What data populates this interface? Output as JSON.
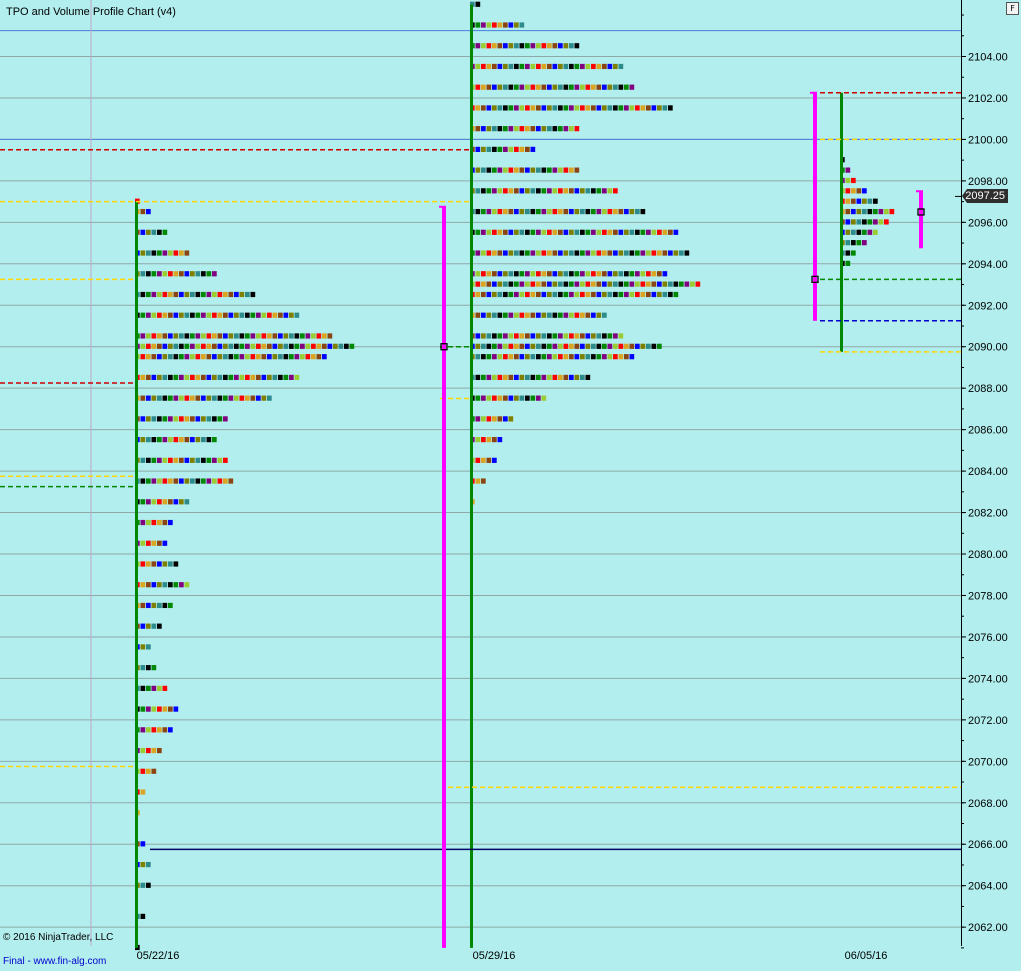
{
  "app": {
    "title": "TPO and Volume Profile Chart (v4)",
    "copyright": "© 2016 NinjaTrader, LLC",
    "footer_link": "Final - www.fin-alg.com",
    "corner_button": "F",
    "last_price": "2097.25"
  },
  "colors": {
    "background": "#b2eeee",
    "grid": "#8fa8a8",
    "poc": "#ff00ff",
    "value_area_line": "#ffd700",
    "vah_line": "#cc0000",
    "val_line": "#008800",
    "tpo_palette": [
      "#000000",
      "#0000ff",
      "#ff0000",
      "#008800",
      "#808000",
      "#daa520",
      "#800080",
      "#2e8b8b",
      "#8b4513",
      "#9acd32"
    ]
  },
  "chart_data": {
    "type": "tpo_market_profile",
    "y_axis": {
      "ylim": [
        2061.0,
        2107.0
      ],
      "ticks": [
        "2062.00",
        "2064.00",
        "2066.00",
        "2068.00",
        "2070.00",
        "2072.00",
        "2074.00",
        "2076.00",
        "2078.00",
        "2080.00",
        "2082.00",
        "2084.00",
        "2086.00",
        "2088.00",
        "2090.00",
        "2092.00",
        "2094.00",
        "2096.00",
        "2098.00",
        "2100.00",
        "2102.00",
        "2104.00"
      ],
      "tick_values": [
        2062,
        2064,
        2066,
        2068,
        2070,
        2072,
        2074,
        2076,
        2078,
        2080,
        2082,
        2084,
        2086,
        2088,
        2090,
        2092,
        2094,
        2096,
        2098,
        2100,
        2102,
        2104
      ]
    },
    "x_axis": {
      "dates": [
        "05/22/16",
        "05/29/16",
        "06/05/16"
      ]
    },
    "grid": true,
    "last_price": 2097.25,
    "profiles": [
      {
        "low": 2061.0,
        "high": 2097.0,
        "poc": 2090.0,
        "vah": 2088.25,
        "val": 2083.25,
        "va_top": 2093.25,
        "va_bottom": 2069.75,
        "extra_level": 2083.75,
        "tpo_widths": [
          [
            2061.0,
            1
          ],
          [
            2062.5,
            2
          ],
          [
            2064.0,
            3
          ],
          [
            2065.0,
            3
          ],
          [
            2066.0,
            2
          ],
          [
            2067.5,
            1
          ],
          [
            2068.5,
            2
          ],
          [
            2069.5,
            4
          ],
          [
            2070.5,
            5
          ],
          [
            2071.5,
            7
          ],
          [
            2072.5,
            8
          ],
          [
            2073.5,
            6
          ],
          [
            2074.5,
            4
          ],
          [
            2075.5,
            3
          ],
          [
            2076.5,
            5
          ],
          [
            2077.5,
            7
          ],
          [
            2078.5,
            10
          ],
          [
            2079.5,
            8
          ],
          [
            2080.5,
            6
          ],
          [
            2081.5,
            7
          ],
          [
            2082.5,
            10
          ],
          [
            2083.5,
            18
          ],
          [
            2084.5,
            17
          ],
          [
            2085.5,
            15
          ],
          [
            2086.5,
            17
          ],
          [
            2087.5,
            25
          ],
          [
            2088.5,
            30
          ],
          [
            2089.5,
            35
          ],
          [
            2090.0,
            40
          ],
          [
            2090.5,
            36
          ],
          [
            2091.5,
            30
          ],
          [
            2092.5,
            22
          ],
          [
            2093.5,
            15
          ],
          [
            2094.5,
            10
          ],
          [
            2095.5,
            6
          ],
          [
            2096.5,
            3
          ],
          [
            2097.0,
            1
          ]
        ]
      },
      {
        "low": 2061.0,
        "high": 2106.5,
        "poc": 2097.0,
        "vah": 2099.5,
        "val": 2090.0,
        "va_top": 2097.0,
        "va_bottom": 2068.75,
        "extra_level": 2087.5,
        "tpo_widths": [
          [
            2082.5,
            1
          ],
          [
            2083.5,
            3
          ],
          [
            2084.5,
            5
          ],
          [
            2085.5,
            6
          ],
          [
            2086.5,
            8
          ],
          [
            2087.5,
            14
          ],
          [
            2088.5,
            22
          ],
          [
            2089.5,
            30
          ],
          [
            2090.0,
            35
          ],
          [
            2090.5,
            28
          ],
          [
            2091.5,
            25
          ],
          [
            2092.5,
            38
          ],
          [
            2093.0,
            42
          ],
          [
            2093.5,
            36
          ],
          [
            2094.5,
            40
          ],
          [
            2095.5,
            38
          ],
          [
            2096.5,
            32
          ],
          [
            2097.5,
            27
          ],
          [
            2098.5,
            20
          ],
          [
            2099.5,
            12
          ],
          [
            2100.5,
            20
          ],
          [
            2101.5,
            37
          ],
          [
            2102.5,
            30
          ],
          [
            2103.5,
            28
          ],
          [
            2104.5,
            20
          ],
          [
            2105.5,
            10
          ],
          [
            2106.5,
            2
          ]
        ]
      },
      {
        "low": 2089.75,
        "high": 2102.25,
        "poc": 2093.25,
        "vah": 2102.25,
        "val": 2093.25,
        "va_top": 2100.0,
        "va_bottom": 2089.75,
        "extra_level": 2091.25,
        "tpo_widths": [
          [
            2094.0,
            2
          ],
          [
            2094.5,
            3
          ],
          [
            2095.0,
            5
          ],
          [
            2095.5,
            7
          ],
          [
            2096.0,
            9
          ],
          [
            2096.5,
            10
          ],
          [
            2097.0,
            7
          ],
          [
            2097.5,
            5
          ],
          [
            2098.0,
            3
          ],
          [
            2098.5,
            2
          ],
          [
            2099.0,
            1
          ]
        ]
      }
    ]
  }
}
